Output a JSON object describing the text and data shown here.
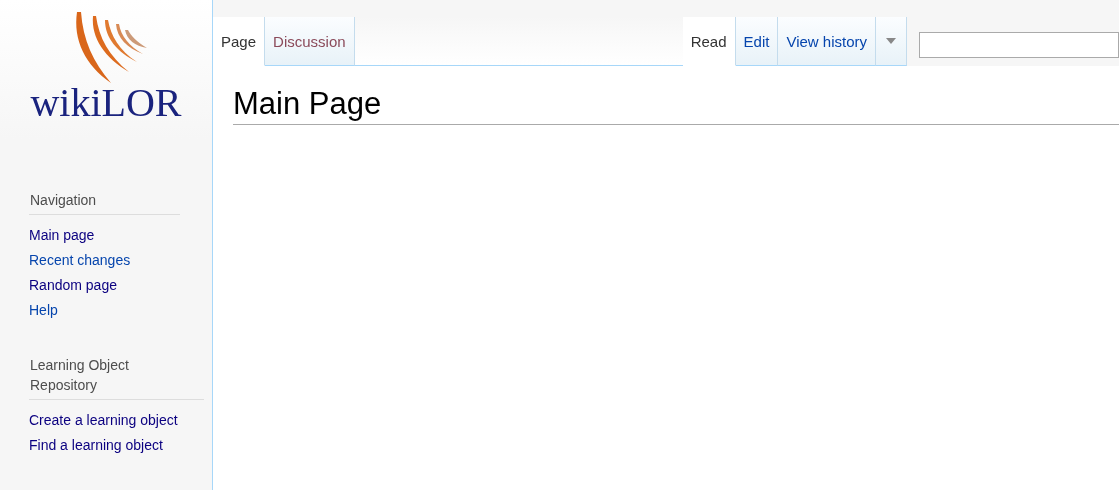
{
  "logo": {
    "text": "wikiLOR"
  },
  "left_tabs": [
    {
      "label": "Page",
      "selected": true,
      "visited": false
    },
    {
      "label": "Discussion",
      "selected": false,
      "visited": true
    }
  ],
  "right_tabs": [
    {
      "label": "Read",
      "selected": true,
      "visited": false
    },
    {
      "label": "Edit",
      "selected": false,
      "visited": false
    },
    {
      "label": "View history",
      "selected": false,
      "visited": false
    }
  ],
  "more_menu": {
    "expanded": false
  },
  "heading": "Main Page",
  "sidebar": [
    {
      "title": "Navigation",
      "items": [
        {
          "label": "Main page",
          "visited": true
        },
        {
          "label": "Recent changes",
          "visited": false
        },
        {
          "label": "Random page",
          "visited": true
        },
        {
          "label": "Help",
          "visited": false
        }
      ]
    },
    {
      "title": "Learning Object Repository",
      "items": [
        {
          "label": "Create a learning object",
          "visited": true
        },
        {
          "label": "Find a learning object",
          "visited": true
        }
      ]
    }
  ]
}
